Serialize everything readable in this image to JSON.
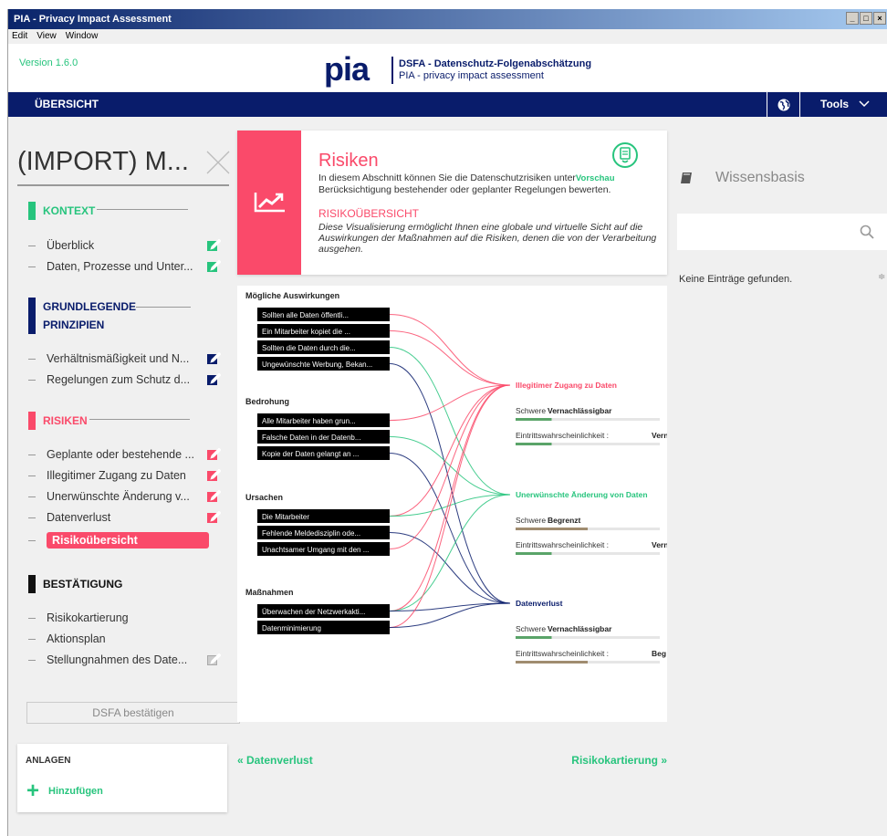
{
  "window": {
    "title": "PIA - Privacy Impact Assessment",
    "controls": [
      "_",
      "□",
      "×"
    ]
  },
  "menu": [
    "Edit",
    "View",
    "Window"
  ],
  "header": {
    "version": "Version 1.6.0",
    "logo": "pia",
    "tag1": "DSFA - Datenschutz-Folgenabschätzung",
    "tag2": "PIA - privacy impact assessment"
  },
  "nav": {
    "title": "ÜBERSICHT",
    "tools": "Tools"
  },
  "sidebar": {
    "title": "(IMPORT) M...",
    "sections": [
      {
        "label": "KONTEXT",
        "color": "#27c47d",
        "items": [
          "Überblick",
          "Daten, Prozesse und Unter..."
        ]
      },
      {
        "label": "GRUNDLEGENDE PRINZIPIEN",
        "color": "#091c6b",
        "items": [
          "Verhältnismäßigkeit und N...",
          "Regelungen zum Schutz d..."
        ]
      },
      {
        "label": "RISIKEN",
        "color": "#fa4a6a",
        "items": [
          "Geplante oder bestehende ...",
          "Illegitimer Zugang zu Daten",
          "Unerwünschte Änderung v...",
          "Datenverlust",
          "Risikoübersicht"
        ]
      },
      {
        "label": "BESTÄTIGUNG",
        "color": "#111111",
        "items": [
          "Risikokartierung",
          "Aktionsplan",
          "Stellungnahmen des Date..."
        ]
      }
    ],
    "confirm": "DSFA bestätigen",
    "attachments": {
      "title": "ANLAGEN",
      "add": "Hinzufügen"
    }
  },
  "card": {
    "title": "Risiken",
    "text": "In diesem Abschnitt können Sie die Datenschutzrisiken unter",
    "preview": "Vorschau",
    "text2": "Berücksichtigung bestehender oder geplanter Regelungen bewerten.",
    "subtitle": "RISIKOÜBERSICHT",
    "subtext": "Diese Visualisierung ermöglicht Ihnen eine globale und virtuelle Sicht auf die Auswirkungen der Maßnahmen auf die Risiken, denen die von der Verarbeitung ausgehen."
  },
  "viz": {
    "groups": [
      {
        "title": "Mögliche Auswirkungen",
        "items": [
          "Sollten alle Daten öffentli...",
          "Ein Mitarbeiter kopiet die ...",
          "Sollten die Daten durch die...",
          "Ungewünschte Werbung, Bekan..."
        ]
      },
      {
        "title": "Bedrohung",
        "items": [
          "Alle Mitarbeiter haben grun...",
          "Falsche Daten in der Datenb...",
          "Kopie der Daten gelangt an ..."
        ]
      },
      {
        "title": "Ursachen",
        "items": [
          "Die Mitarbeiter",
          "Fehlende Meldedisziplin ode...",
          "Unachtsamer Umgang mit den ..."
        ]
      },
      {
        "title": "Maßnahmen",
        "items": [
          "Überwachen der Netzwerkakti...",
          "Datenminimierung"
        ]
      }
    ],
    "risks": [
      {
        "title": "Illegitimer Zugang zu Daten",
        "color": "#fa4a6a",
        "severity_label": "Schwere",
        "severity": "Vernachlässigbar",
        "severity_level": 0.25,
        "severity_color": "#5aa469",
        "likelihood_label": "Eintrittswahrscheinlichkeit :",
        "likelihood": "Vern",
        "likelihood_level": 0.25,
        "likelihood_color": "#5aa469"
      },
      {
        "title": "Unerwünschte Änderung von Daten",
        "color": "#27c47d",
        "severity_label": "Schwere",
        "severity": "Begrenzt",
        "severity_level": 0.5,
        "severity_color": "#a08c70",
        "likelihood_label": "Eintrittswahrscheinlichkeit :",
        "likelihood": "Vern",
        "likelihood_level": 0.25,
        "likelihood_color": "#5aa469"
      },
      {
        "title": "Datenverlust",
        "color": "#091c6b",
        "severity_label": "Schwere",
        "severity": "Vernachlässigbar",
        "severity_level": 0.25,
        "severity_color": "#5aa469",
        "likelihood_label": "Eintrittswahrscheinlichkeit :",
        "likelihood": "Beg",
        "likelihood_level": 0.5,
        "likelihood_color": "#a08c70"
      }
    ]
  },
  "pager": {
    "prev": "« Datenverlust",
    "next": "Risikokartierung »"
  },
  "knowledge": {
    "title": "Wissensbasis",
    "empty": "Keine Einträge gefunden.",
    "sort": "≑"
  }
}
